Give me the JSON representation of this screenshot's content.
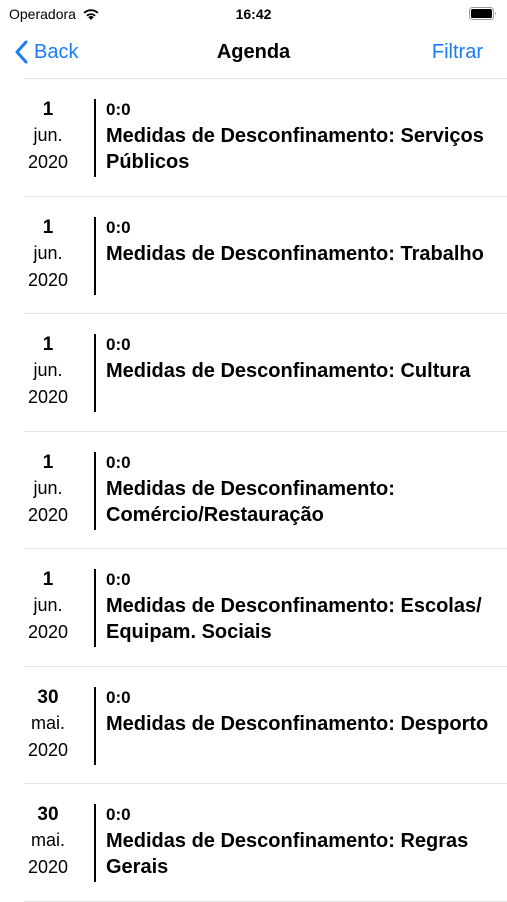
{
  "status_bar": {
    "carrier": "Operadora",
    "time": "16:42",
    "wifi_icon": "wifi-icon",
    "battery_icon": "battery-icon"
  },
  "nav": {
    "back_label": "Back",
    "title": "Agenda",
    "filter_label": "Filtrar",
    "accent_color": "#1a7cf5"
  },
  "events": [
    {
      "day": "1",
      "month": "jun.",
      "year": "2020",
      "time": "0:0",
      "title": "Medidas de Desconfinamento: Serviços Públicos"
    },
    {
      "day": "1",
      "month": "jun.",
      "year": "2020",
      "time": "0:0",
      "title": "Medidas de Desconfinamento: Trabalho"
    },
    {
      "day": "1",
      "month": "jun.",
      "year": "2020",
      "time": "0:0",
      "title": "Medidas de Desconfinamento: Cultura"
    },
    {
      "day": "1",
      "month": "jun.",
      "year": "2020",
      "time": "0:0",
      "title": "Medidas de Desconfinamento: Comércio/Restauração"
    },
    {
      "day": "1",
      "month": "jun.",
      "year": "2020",
      "time": "0:0",
      "title": "Medidas de Desconfinamento: Escolas/ Equipam. Sociais"
    },
    {
      "day": "30",
      "month": "mai.",
      "year": "2020",
      "time": "0:0",
      "title": "Medidas de Desconfinamento: Desporto"
    },
    {
      "day": "30",
      "month": "mai.",
      "year": "2020",
      "time": "0:0",
      "title": "Medidas de Desconfinamento: Regras Gerais"
    }
  ]
}
